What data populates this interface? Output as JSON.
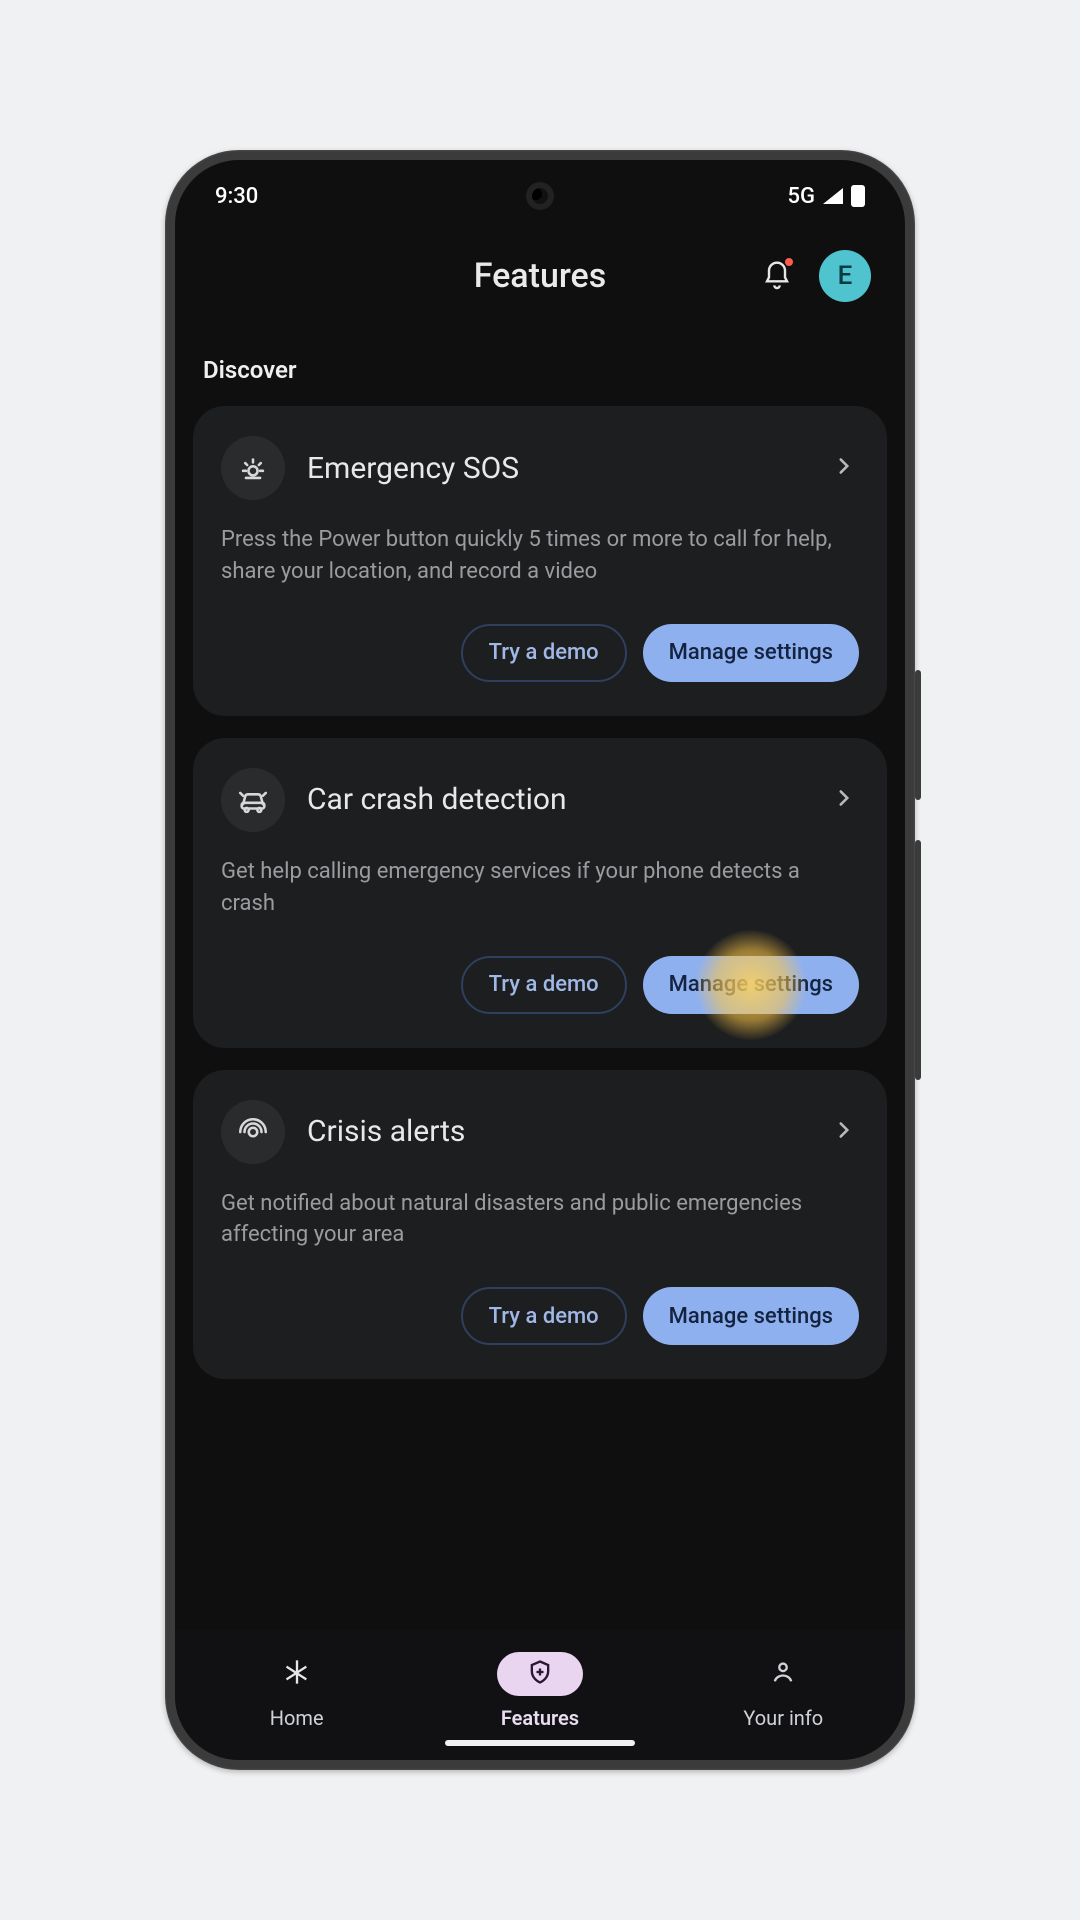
{
  "statusbar": {
    "time": "9:30",
    "network": "5G"
  },
  "header": {
    "title": "Features",
    "avatar_initial": "E"
  },
  "section_label": "Discover",
  "cards": [
    {
      "title": "Emergency SOS",
      "desc": "Press the Power button quickly 5 times or more to call for help, share your location, and record a video",
      "demo_label": "Try a demo",
      "manage_label": "Manage settings"
    },
    {
      "title": "Car crash detection",
      "desc": "Get help calling emergency services if your phone detects a crash",
      "demo_label": "Try a demo",
      "manage_label": "Manage settings"
    },
    {
      "title": "Crisis alerts",
      "desc": "Get notified about natural disasters and public emergencies affecting your area",
      "demo_label": "Try a demo",
      "manage_label": "Manage settings"
    }
  ],
  "bottomnav": {
    "home": "Home",
    "features": "Features",
    "your_info": "Your info"
  }
}
